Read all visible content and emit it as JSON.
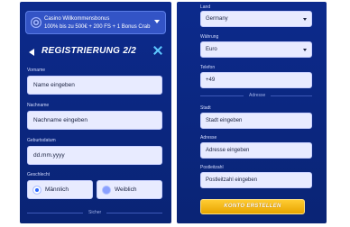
{
  "bonus": {
    "title": "Casino Willkommensbonus",
    "text": "100% bis zu 500€ + 200 FS + 1 Bonus Crab"
  },
  "header": {
    "title": "REGISTRIERUNG 2/2"
  },
  "form_left": {
    "first_name": {
      "label": "Vorname",
      "placeholder": "Name eingeben"
    },
    "last_name": {
      "label": "Nachname",
      "placeholder": "Nachname eingeben"
    },
    "birthdate": {
      "label": "Geburtsdatum",
      "placeholder": "dd.mm.yyyy"
    },
    "gender": {
      "label": "Geschlecht",
      "options": [
        "Männlich",
        "Weiblich"
      ],
      "selected": "Männlich"
    },
    "divider_label": "Sicher"
  },
  "form_right": {
    "country": {
      "label": "Land",
      "value": "Germany"
    },
    "currency": {
      "label": "Währung",
      "value": "Euro"
    },
    "phone": {
      "label": "Telefon",
      "value": "+49"
    },
    "divider_label": "Adresse",
    "city": {
      "label": "Stadt",
      "placeholder": "Stadt eingeben"
    },
    "address": {
      "label": "Adresse",
      "placeholder": "Adresse eingeben"
    },
    "postal": {
      "label": "Postleitzahl",
      "placeholder": "Postleitzahl eingeben"
    },
    "submit_label": "KONTO ERSTELLEN"
  },
  "colors": {
    "panel_bg": "#0c2a8c",
    "accent_button": "#f5b400",
    "radio_checked": "#2b68ff"
  }
}
